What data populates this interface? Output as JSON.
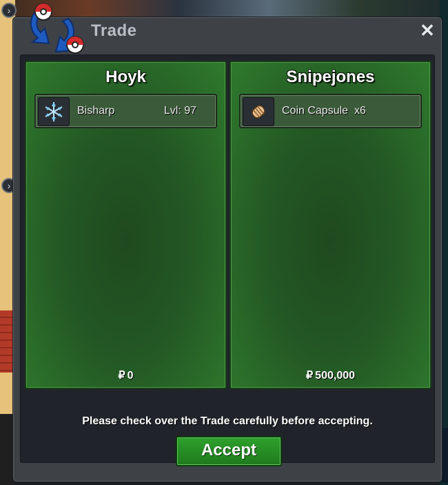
{
  "window": {
    "title": "Trade",
    "close_label": "✕"
  },
  "panels": [
    {
      "player": "Hoyk",
      "items": [
        {
          "name": "Bisharp",
          "level": "Lvl: 97",
          "icon": "ice-shard-icon"
        }
      ],
      "money_symbol": "₽",
      "money": "0"
    },
    {
      "player": "Snipejones",
      "items": [
        {
          "name": "Coin Capsule  x6",
          "level": "",
          "icon": "capsule-icon"
        }
      ],
      "money_symbol": "₽",
      "money": "500,000"
    }
  ],
  "notice": "Please check over the Trade carefully before accepting.",
  "accept_label": "Accept",
  "colors": {
    "panel_green": "#235724",
    "accept_green": "#2ea02c",
    "window_gray": "#3e4247"
  }
}
